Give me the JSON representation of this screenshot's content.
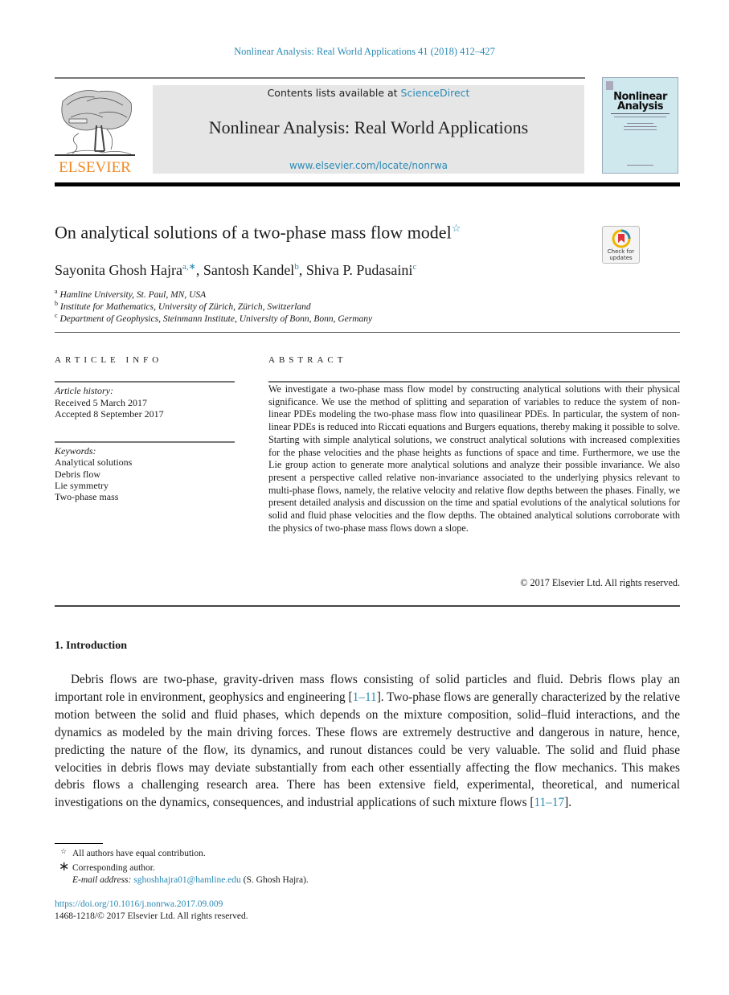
{
  "journal_ref": "Nonlinear Analysis: Real World Applications 41 (2018) 412–427",
  "header": {
    "publisher_logo_text": "ELSEVIER",
    "contents_prefix": "Contents lists available at ",
    "contents_link": "ScienceDirect",
    "journal_title": "Nonlinear Analysis: Real World Applications",
    "journal_url": "www.elsevier.com/locate/nonrwa",
    "cover_title_line1": "Nonlinear",
    "cover_title_line2": "Analysis"
  },
  "article": {
    "title": "On analytical solutions of a two-phase mass flow model",
    "title_note_mark": "☆",
    "check_updates_label_1": "Check for",
    "check_updates_label_2": "updates",
    "authors": [
      {
        "name": "Sayonita Ghosh Hajra",
        "sup": "a,∗",
        "sep": ", "
      },
      {
        "name": "Santosh Kandel",
        "sup": "b",
        "sep": ", "
      },
      {
        "name": "Shiva P. Pudasaini",
        "sup": "c",
        "sep": ""
      }
    ],
    "affiliations": [
      {
        "mark": "a",
        "text": "Hamline University, St. Paul, MN, USA"
      },
      {
        "mark": "b",
        "text": "Institute for Mathematics, University of Zürich, Zürich, Switzerland"
      },
      {
        "mark": "c",
        "text": "Department of Geophysics, Steinmann Institute, University of Bonn, Bonn, Germany"
      }
    ]
  },
  "article_info": {
    "heading": "ARTICLE INFO",
    "history_label": "Article history:",
    "received": "Received 5 March 2017",
    "accepted": "Accepted 8 September 2017",
    "keywords_label": "Keywords:",
    "keywords": [
      "Analytical solutions",
      "Debris flow",
      "Lie symmetry",
      "Two-phase mass"
    ]
  },
  "abstract": {
    "heading": "ABSTRACT",
    "text": "We investigate a two-phase mass flow model by constructing analytical solutions with their physical significance. We use the method of splitting and separation of variables to reduce the system of non-linear PDEs modeling the two-phase mass flow into quasilinear PDEs. In particular, the system of non-linear PDEs is reduced into Riccati equations and Burgers equations, thereby making it possible to solve. Starting with simple analytical solutions, we construct analytical solutions with increased complexities for the phase velocities and the phase heights as functions of space and time. Furthermore, we use the Lie group action to generate more analytical solutions and analyze their possible invariance. We also present a perspective called relative non-invariance associated to the underlying physics relevant to multi-phase flows, namely, the relative velocity and relative flow depths between the phases. Finally, we present detailed analysis and discussion on the time and spatial evolutions of the analytical solutions for solid and fluid phase velocities and the flow depths. The obtained analytical solutions corroborate with the physics of two-phase mass flows down a slope.",
    "copyright": "© 2017 Elsevier Ltd. All rights reserved."
  },
  "introduction": {
    "heading": "1.  Introduction",
    "p1_a": "Debris flows are two-phase, gravity-driven mass flows consisting of solid particles and fluid. Debris flows play an important role in environment, geophysics and engineering [",
    "cite1": "1–11",
    "p1_b": "]. Two-phase flows are generally characterized by the relative motion between the solid and fluid phases, which depends on the mixture composition, solid–fluid interactions, and the dynamics as modeled by the main driving forces. These flows are extremely destructive and dangerous in nature, hence, predicting the nature of the flow, its dynamics, and runout distances could be very valuable. The solid and fluid phase velocities in debris flows may deviate substantially from each other essentially affecting the flow mechanics. This makes debris flows a challenging research area. There has been extensive field, experimental, theoretical, and numerical investigations on the dynamics, consequences, and industrial applications of such mixture flows [",
    "cite2": "11–17",
    "p1_c": "]."
  },
  "footnotes": {
    "star_mark": "☆",
    "star_text": "All authors have equal contribution.",
    "corr_mark": "∗",
    "corr_text": "Corresponding author.",
    "email_label": "E-mail address:",
    "email": "sghoshhajra01@hamline.edu",
    "email_suffix": " (S. Ghosh Hajra).",
    "doi": "https://doi.org/10.1016/j.nonrwa.2017.09.009",
    "issn": "1468-1218/© 2017 Elsevier Ltd. All rights reserved."
  },
  "colors": {
    "link": "#2a8ab5",
    "elsevier_orange": "#f08a24",
    "banner_gray": "#e6e6e6",
    "cover_blue": "#cfe8ee"
  }
}
